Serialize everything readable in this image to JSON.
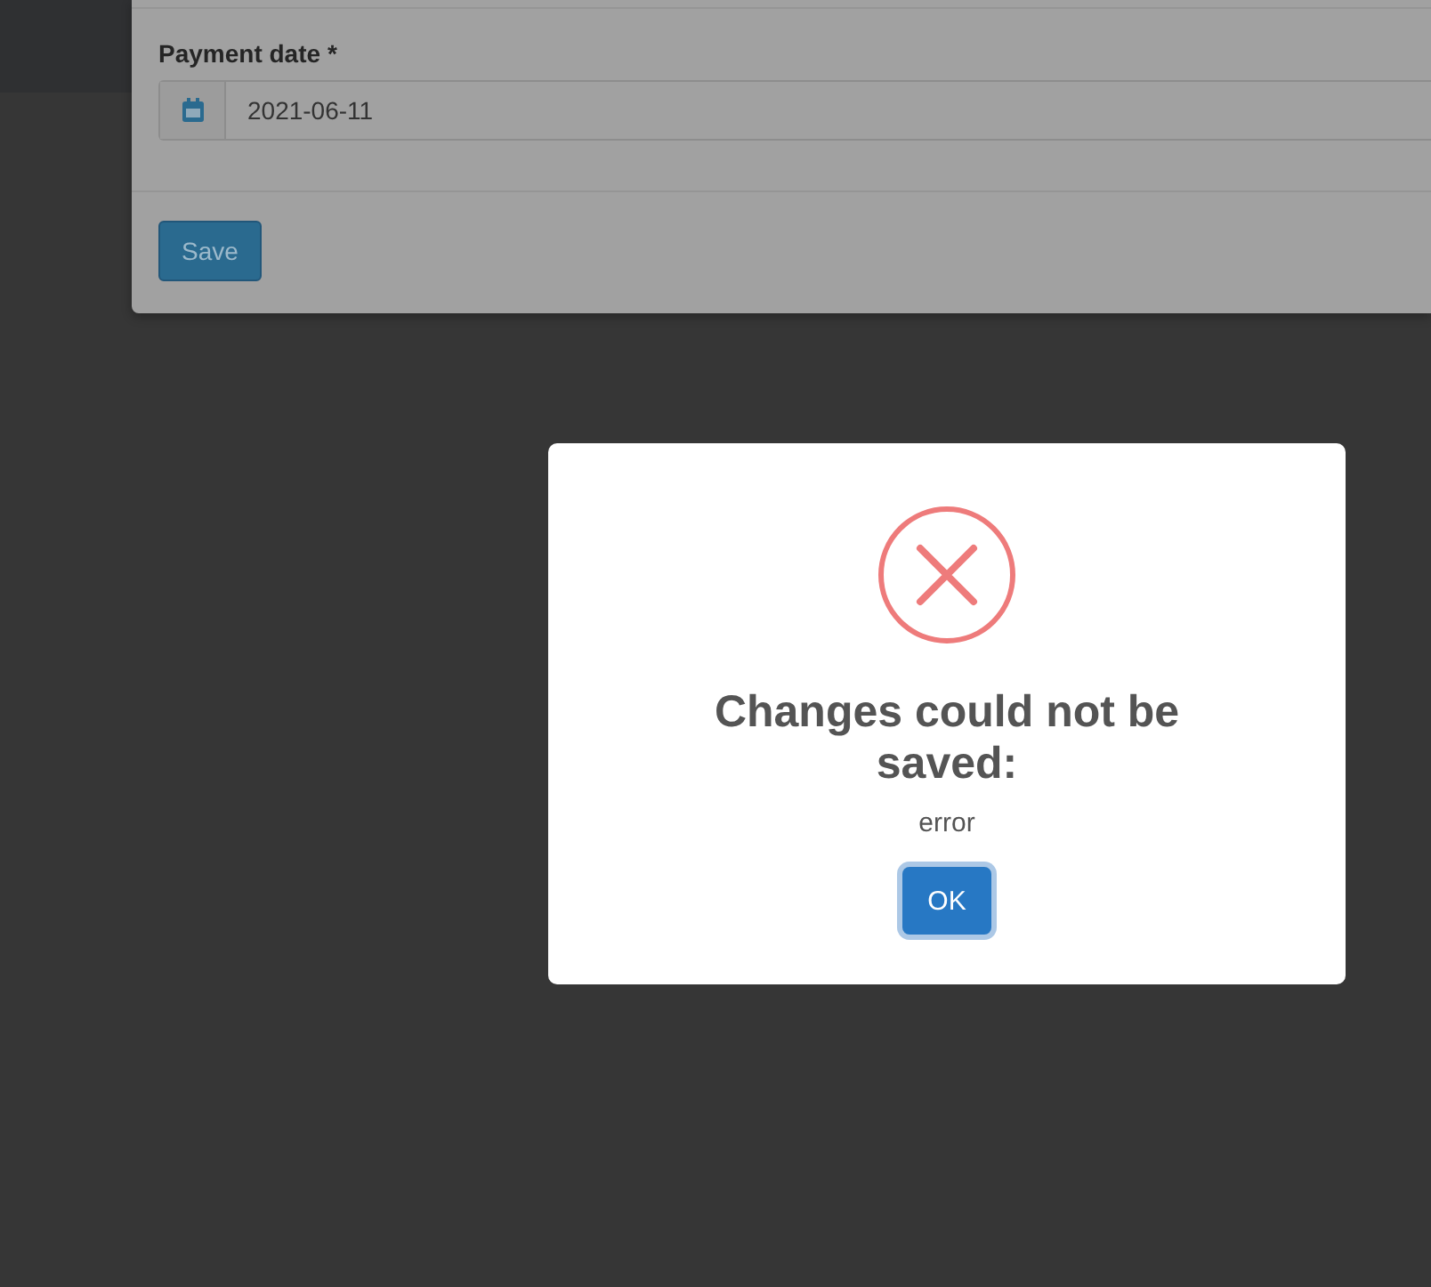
{
  "form": {
    "field": {
      "label": "Payment date",
      "required_mark": "*",
      "value": "2021-06-11"
    },
    "save_button": "Save"
  },
  "alert": {
    "kind": "error",
    "title": "Changes could not be saved:",
    "message": "error",
    "confirm_button": "OK"
  }
}
